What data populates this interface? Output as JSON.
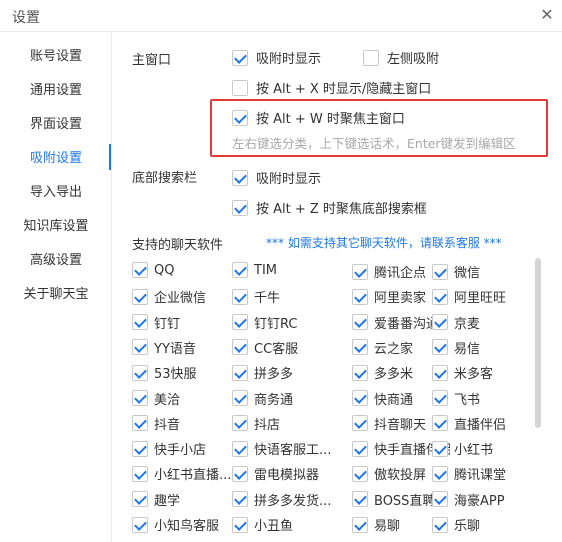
{
  "window": {
    "title": "设置",
    "close_glyph": "✕"
  },
  "sidebar": {
    "items": [
      {
        "label": "账号设置"
      },
      {
        "label": "通用设置"
      },
      {
        "label": "界面设置"
      },
      {
        "label": "吸附设置",
        "active": true
      },
      {
        "label": "导入导出"
      },
      {
        "label": "知识库设置"
      },
      {
        "label": "高级设置"
      },
      {
        "label": "关于聊天宝"
      }
    ]
  },
  "main_window": {
    "label": "主窗口",
    "show_on_attach": {
      "label": "吸附时显示",
      "checked": true
    },
    "left_attach": {
      "label": "左侧吸附",
      "checked": false
    },
    "alt_x": {
      "label": "按 Alt + X 时显示/隐藏主窗口",
      "checked": false
    },
    "alt_w": {
      "label": "按 Alt + W 时聚焦主窗口",
      "checked": true
    },
    "hint": "左右键选分类，上下键选话术，Enter键发到编辑区"
  },
  "bottom_search": {
    "label": "底部搜索栏",
    "show_on_attach": {
      "label": "吸附时显示",
      "checked": true
    },
    "alt_z": {
      "label": "按 Alt + Z 时聚焦底部搜索框",
      "checked": true
    }
  },
  "supported": {
    "label": "支持的聊天软件",
    "note": "*** 如需支持其它聊天软件，请联系客服 ***",
    "columns": [
      [
        "QQ",
        "企业微信",
        "钉钉",
        "YY语音",
        "53快服",
        "美洽",
        "抖音",
        "快手小店",
        "小红书直播...",
        "趣学",
        "小知鸟客服"
      ],
      [
        "TIM",
        "千牛",
        "钉钉RC",
        "CC客服",
        "拼多多",
        "商务通",
        "抖店",
        "快语客服工...",
        "雷电模拟器",
        "拼多多发货...",
        "小丑鱼"
      ],
      [
        "腾讯企点",
        "阿里卖家",
        "爱番番沟通",
        "云之家",
        "多多米",
        "快商通",
        "抖音聊天",
        "快手直播伴侣",
        "傲软投屏",
        "BOSS直聘",
        "易聊"
      ],
      [
        "微信",
        "阿里旺旺",
        "京麦",
        "易信",
        "米多客",
        "飞书",
        "直播伴侣",
        "小红书",
        "腾讯课堂",
        "海豪APP",
        "乐聊"
      ]
    ]
  },
  "colors": {
    "accent": "#1e78e6",
    "highlight_border": "#e53935",
    "hint": "#a8a8a8"
  }
}
